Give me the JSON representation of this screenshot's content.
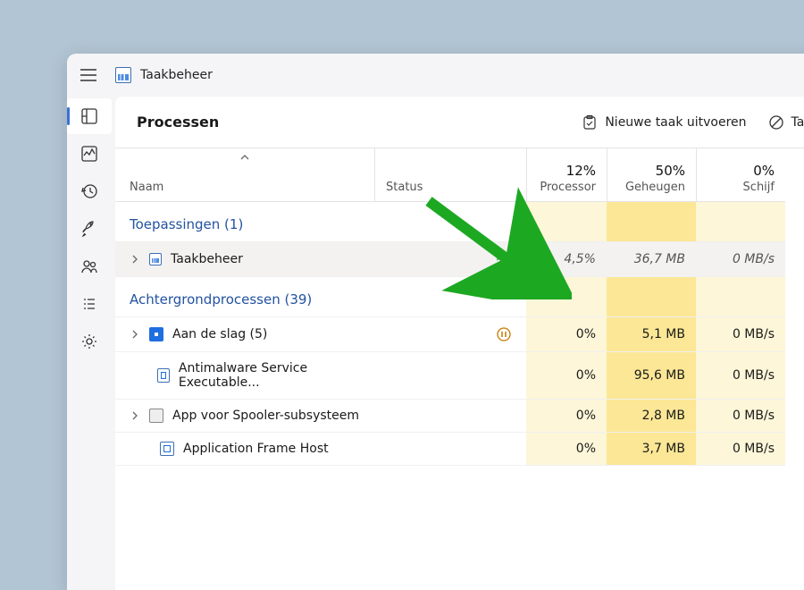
{
  "app": {
    "title": "Taakbeheer"
  },
  "sidebar": {
    "items": [
      {
        "name": "processes",
        "selected": true
      },
      {
        "name": "performance"
      },
      {
        "name": "app-history"
      },
      {
        "name": "startup"
      },
      {
        "name": "users"
      },
      {
        "name": "details"
      },
      {
        "name": "settings"
      }
    ]
  },
  "header": {
    "title": "Processen",
    "run_new": "Nieuwe taak uitvoeren",
    "end_task": "Taak be"
  },
  "columns": {
    "name": "Naam",
    "status": "Status",
    "cpu_pct": "12%",
    "cpu_label": "Processor",
    "mem_pct": "50%",
    "mem_label": "Geheugen",
    "disk_pct": "0%",
    "disk_label": "Schijf"
  },
  "groups": [
    {
      "title": "Toepassingen (1)",
      "rows": [
        {
          "expand": true,
          "icon": "taskmgr",
          "name": "Taakbeheer",
          "status": "leaf",
          "cpu": "4,5%",
          "mem": "36,7 MB",
          "disk": "0 MB/s",
          "selected": true
        }
      ]
    },
    {
      "title": "Achtergrondprocessen (39)",
      "rows": [
        {
          "expand": true,
          "icon": "blue-square",
          "name": "Aan de slag (5)",
          "status": "pause",
          "cpu": "0%",
          "mem": "5,1 MB",
          "disk": "0 MB/s"
        },
        {
          "expand": false,
          "indent": true,
          "icon": "framed",
          "name": "Antimalware Service Executable...",
          "cpu": "0%",
          "mem": "95,6 MB",
          "disk": "0 MB/s"
        },
        {
          "expand": true,
          "icon": "printer",
          "name": "App voor Spooler-subsysteem",
          "cpu": "0%",
          "mem": "2,8 MB",
          "disk": "0 MB/s"
        },
        {
          "expand": false,
          "indent": true,
          "icon": "framed",
          "name": "Application Frame Host",
          "cpu": "0%",
          "mem": "3,7 MB",
          "disk": "0 MB/s"
        }
      ]
    }
  ]
}
